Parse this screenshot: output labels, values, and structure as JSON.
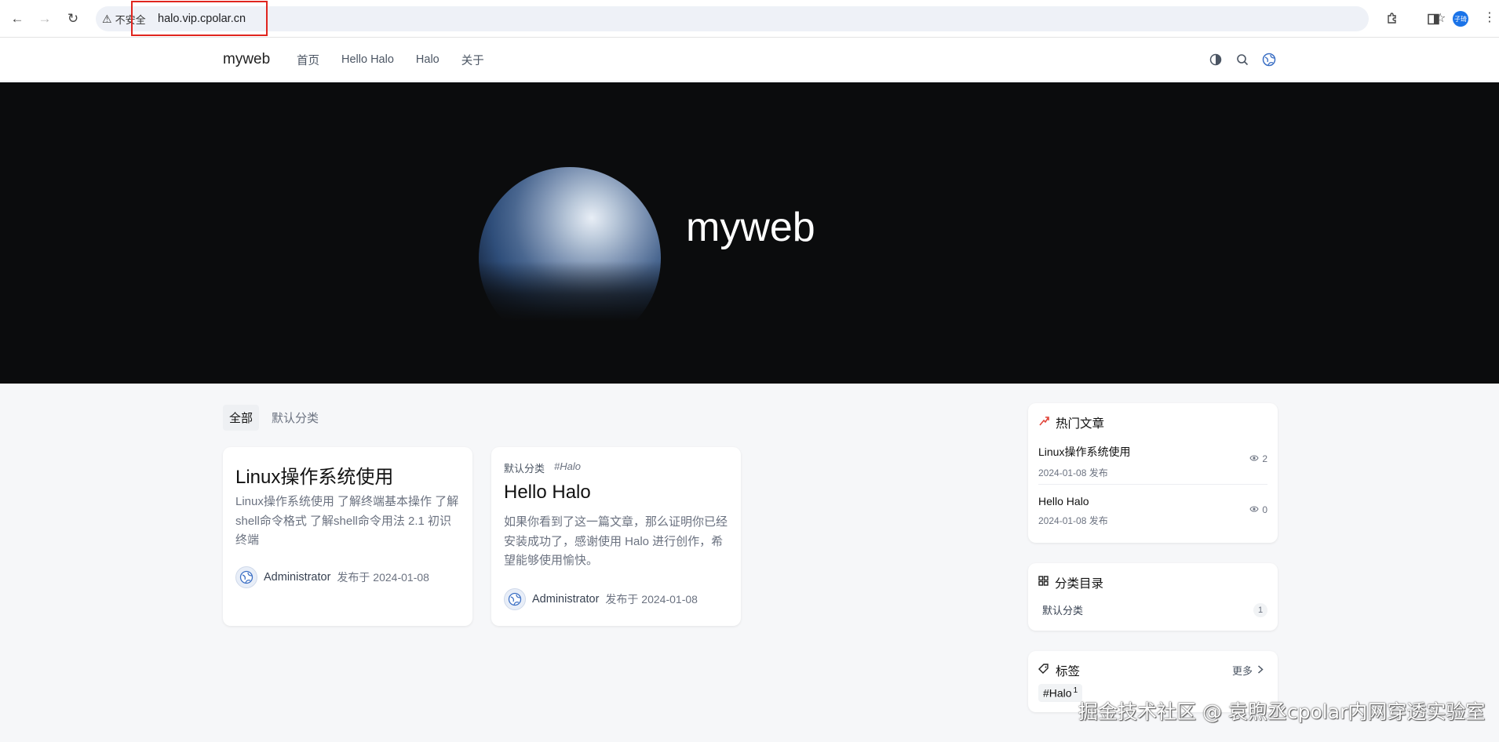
{
  "browser": {
    "security_label": "不安全",
    "url": "halo.vip.cpolar.cn",
    "profile_initials": "子琦"
  },
  "site": {
    "brand": "myweb",
    "menu": [
      "首页",
      "Hello Halo",
      "Halo",
      "关于"
    ]
  },
  "hero": {
    "title": "myweb"
  },
  "tabs": [
    "全部",
    "默认分类"
  ],
  "posts": [
    {
      "title": "Linux操作系统使用",
      "excerpt": "Linux操作系统使用 了解终端基本操作 了解shell命令格式 了解shell命令用法 2.1 初识终端",
      "author": "Administrator",
      "date": "发布于 2024-01-08"
    },
    {
      "category": "默认分类",
      "tag": "#Halo",
      "title": "Hello Halo",
      "excerpt": "如果你看到了这一篇文章，那么证明你已经安装成功了，感谢使用 Halo 进行创作，希望能够使用愉快。",
      "author": "Administrator",
      "date": "发布于 2024-01-08"
    }
  ],
  "sidebar": {
    "hot": {
      "title": "热门文章",
      "items": [
        {
          "title": "Linux操作系统使用",
          "date": "2024-01-08 发布",
          "views": "2"
        },
        {
          "title": "Hello Halo",
          "date": "2024-01-08 发布",
          "views": "0"
        }
      ]
    },
    "categories": {
      "title": "分类目录",
      "items": [
        {
          "name": "默认分类",
          "count": "1"
        }
      ]
    },
    "tags": {
      "title": "标签",
      "more": "更多",
      "items": [
        {
          "name": "#Halo",
          "count": "1"
        }
      ]
    }
  },
  "watermark": "掘金技术社区 @ 袁煦丞cpolar内网穿透实验室"
}
